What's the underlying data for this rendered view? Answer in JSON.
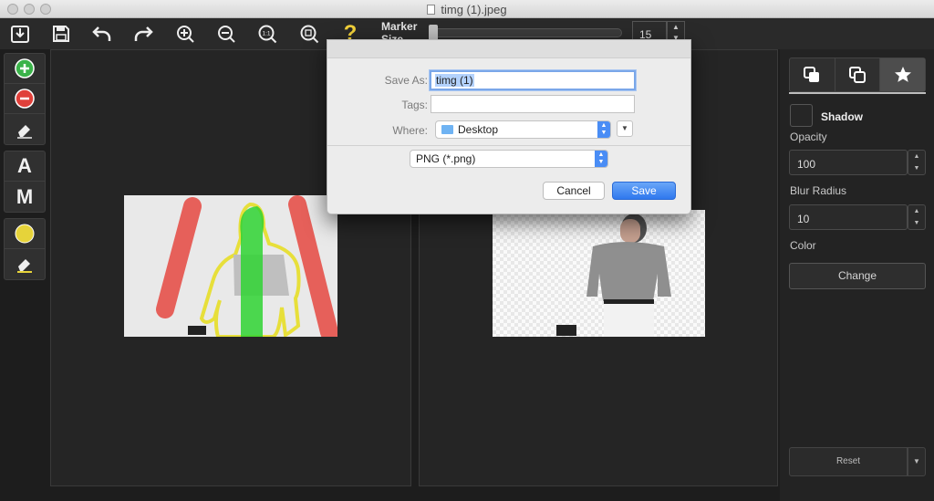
{
  "window": {
    "title": "timg (1).jpeg"
  },
  "toolbar": {
    "icons": [
      "open-icon",
      "save-icon",
      "undo-icon",
      "redo-icon",
      "zoom-in-icon",
      "zoom-out-icon",
      "zoom-actual-icon",
      "zoom-fit-icon",
      "help-icon"
    ],
    "zoom_actual_text": "1:1",
    "help_text": "?",
    "marker_label": "Marker Size",
    "marker_value": "15"
  },
  "left_tools": {
    "auto_label": "A",
    "manual_label": "M",
    "colors": {
      "add": "#3bb34a",
      "remove": "#e0403a",
      "yellow": "#e6d33a"
    }
  },
  "right_panel": {
    "tabs": [
      "layers-front-icon",
      "layers-back-icon",
      "star-icon"
    ],
    "shadow_label": "Shadow",
    "opacity_label": "Opacity",
    "opacity_value": "100",
    "blur_label": "Blur Radius",
    "blur_value": "10",
    "color_label": "Color",
    "change_button": "Change",
    "reset_button": "Reset"
  },
  "dialog": {
    "save_as_label": "Save As:",
    "save_as_value": "timg (1)",
    "tags_label": "Tags:",
    "tags_value": "",
    "where_label": "Where:",
    "where_value": "Desktop",
    "format_value": "PNG (*.png)",
    "cancel_button": "Cancel",
    "save_button": "Save"
  }
}
